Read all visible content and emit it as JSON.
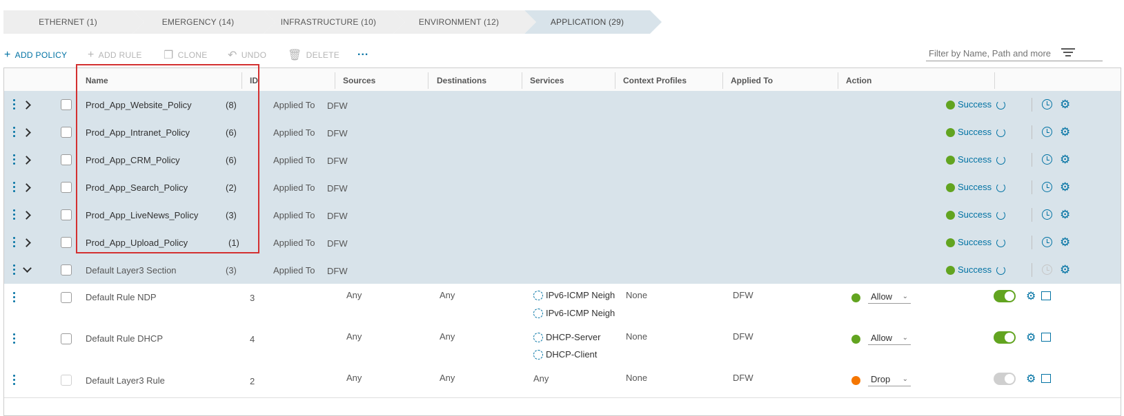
{
  "crumbs": [
    {
      "label": "ETHERNET (1)"
    },
    {
      "label": "EMERGENCY (14)"
    },
    {
      "label": "INFRASTRUCTURE (10)"
    },
    {
      "label": "ENVIRONMENT (12)"
    },
    {
      "label": "APPLICATION (29)"
    }
  ],
  "toolbar": {
    "add_policy": "ADD POLICY",
    "add_rule": "ADD RULE",
    "clone": "CLONE",
    "undo": "UNDO",
    "delete": "DELETE",
    "more": "...",
    "filter_placeholder": "Filter by Name, Path and more"
  },
  "columns": [
    "Name",
    "ID",
    "Sources",
    "Destinations",
    "Services",
    "Context Profiles",
    "Applied To",
    "Action"
  ],
  "policies": [
    {
      "name": "Prod_App_Website_Policy",
      "count": "(8)",
      "applied_label": "Applied To",
      "applied": "DFW",
      "status": "Success"
    },
    {
      "name": "Prod_App_Intranet_Policy",
      "count": "(6)",
      "applied_label": "Applied To",
      "applied": "DFW",
      "status": "Success"
    },
    {
      "name": "Prod_App_CRM_Policy",
      "count": "(6)",
      "applied_label": "Applied To",
      "applied": "DFW",
      "status": "Success"
    },
    {
      "name": "Prod_App_Search_Policy",
      "count": "(2)",
      "applied_label": "Applied To",
      "applied": "DFW",
      "status": "Success"
    },
    {
      "name": "Prod_App_LiveNews_Policy",
      "count": "(3)",
      "applied_label": "Applied To",
      "applied": "DFW",
      "status": "Success"
    },
    {
      "name": "Prod_App_Upload_Policy",
      "count": "(1)",
      "applied_label": "Applied To",
      "applied": "DFW",
      "status": "Success"
    },
    {
      "name": "Default Layer3 Section",
      "count": "(3)",
      "applied_label": "Applied To",
      "applied": "DFW",
      "status": "Success"
    }
  ],
  "rules": [
    {
      "name": "Default Rule NDP",
      "id": "3",
      "sources": "Any",
      "destinations": "Any",
      "services": [
        "IPv6-ICMP Neigh",
        "IPv6-ICMP Neigh"
      ],
      "context": "None",
      "applied": "DFW",
      "action": "Allow"
    },
    {
      "name": "Default Rule DHCP",
      "id": "4",
      "sources": "Any",
      "destinations": "Any",
      "services": [
        "DHCP-Server",
        "DHCP-Client"
      ],
      "context": "None",
      "applied": "DFW",
      "action": "Allow"
    },
    {
      "name": "Default Layer3 Rule",
      "id": "2",
      "sources": "Any",
      "destinations": "Any",
      "services_text": "Any",
      "context": "None",
      "applied": "DFW",
      "action": "Drop"
    }
  ],
  "colors": {
    "accent": "#0072a3",
    "success": "#62a420",
    "drop": "#f57600",
    "highlight": "#d32f2f"
  }
}
